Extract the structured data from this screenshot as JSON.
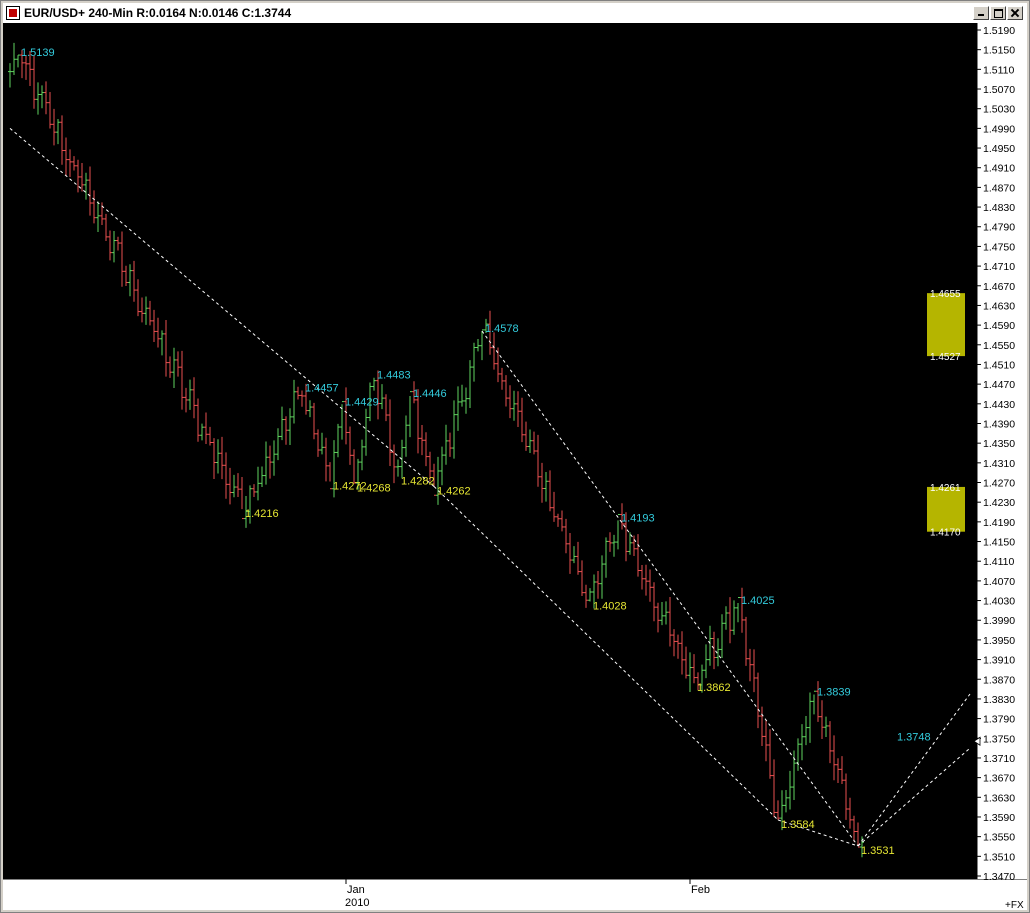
{
  "window": {
    "title": "EUR/USD+ 240-Min R:0.0164 N:0.0146 C:1.3744",
    "min_icon": "minimize-icon",
    "max_icon": "maximize-icon",
    "close_icon": "close-icon"
  },
  "colors": {
    "background": "#000000",
    "up_bar": "#5fd35f",
    "down_bar": "#e85050",
    "high_label": "#33ccdd",
    "low_label": "#e6e633",
    "trendline": "#ffffff",
    "zone_fill": "#b5b500",
    "price_scale_bg": "#ffffff"
  },
  "chart_data": {
    "type": "ohlc",
    "symbol": "EUR/USD+",
    "interval": "240-Min",
    "y_range": [
      1.347,
      1.521
    ],
    "y_ticks": [
      "1.5190",
      "1.5150",
      "1.5110",
      "1.5070",
      "1.5030",
      "1.4990",
      "1.4950",
      "1.4910",
      "1.4870",
      "1.4830",
      "1.4790",
      "1.4750",
      "1.4710",
      "1.4670",
      "1.4630",
      "1.4590",
      "1.4550",
      "1.4510",
      "1.4470",
      "1.4430",
      "1.4390",
      "1.4350",
      "1.4310",
      "1.4270",
      "1.4230",
      "1.4190",
      "1.4150",
      "1.4110",
      "1.4070",
      "1.4030",
      "1.3990",
      "1.3950",
      "1.3910",
      "1.3870",
      "1.3830",
      "1.3790",
      "1.3750",
      "1.3710",
      "1.3670",
      "1.3630",
      "1.3590",
      "1.3550",
      "1.3510",
      "1.3470"
    ],
    "bar_count": 214,
    "x_labels": [
      {
        "bar": 84,
        "month": "Jan",
        "year": "2010"
      },
      {
        "bar": 170,
        "month": "Feb",
        "year": ""
      }
    ],
    "last_price": 1.3744,
    "last_label_suffix": "+FX",
    "swing_points": [
      {
        "bar": 2,
        "price": 1.5139,
        "label": "1.5139",
        "kind": "high"
      },
      {
        "bar": 58,
        "price": 1.4216,
        "label": "1.4216",
        "kind": "low"
      },
      {
        "bar": 73,
        "price": 1.4457,
        "label": "1.4457",
        "kind": "high"
      },
      {
        "bar": 80,
        "price": 1.4272,
        "label": "1.4272",
        "kind": "low"
      },
      {
        "bar": 83,
        "price": 1.4429,
        "label": "1.4429",
        "kind": "high"
      },
      {
        "bar": 86,
        "price": 1.4268,
        "label": "1.4268",
        "kind": "low"
      },
      {
        "bar": 91,
        "price": 1.4483,
        "label": "1.4483",
        "kind": "high"
      },
      {
        "bar": 97,
        "price": 1.4282,
        "label": "1.4282",
        "kind": "low"
      },
      {
        "bar": 100,
        "price": 1.4446,
        "label": "1.4446",
        "kind": "high"
      },
      {
        "bar": 106,
        "price": 1.4262,
        "label": "1.4262",
        "kind": "low"
      },
      {
        "bar": 118,
        "price": 1.4578,
        "label": "1.4578",
        "kind": "high"
      },
      {
        "bar": 145,
        "price": 1.4028,
        "label": "1.4028",
        "kind": "low"
      },
      {
        "bar": 152,
        "price": 1.4193,
        "label": "1.4193",
        "kind": "high"
      },
      {
        "bar": 171,
        "price": 1.3862,
        "label": "1.3862",
        "kind": "low"
      },
      {
        "bar": 182,
        "price": 1.4025,
        "label": "1.4025",
        "kind": "high"
      },
      {
        "bar": 192,
        "price": 1.3584,
        "label": "1.3584",
        "kind": "low"
      },
      {
        "bar": 201,
        "price": 1.3839,
        "label": "1.3839",
        "kind": "high"
      },
      {
        "bar": 212,
        "price": 1.3531,
        "label": "1.3531",
        "kind": "low"
      },
      {
        "bar": 221,
        "price": 1.3748,
        "label": "1.3748",
        "kind": "high"
      }
    ],
    "trendlines": [
      {
        "from": {
          "bar": 0,
          "price": 1.499
        },
        "to": {
          "bar": 106,
          "price": 1.4262
        }
      },
      {
        "from": {
          "bar": 106,
          "price": 1.4262
        },
        "to": {
          "bar": 192,
          "price": 1.3584
        }
      },
      {
        "from": {
          "bar": 118,
          "price": 1.4578
        },
        "to": {
          "bar": 212,
          "price": 1.3531
        }
      },
      {
        "from": {
          "bar": 192,
          "price": 1.3584
        },
        "to": {
          "bar": 212,
          "price": 1.3531
        }
      },
      {
        "from": {
          "bar": 212,
          "price": 1.3531
        },
        "to": {
          "bar": 240,
          "price": 1.384
        }
      },
      {
        "from": {
          "bar": 212,
          "price": 1.3531
        },
        "to": {
          "bar": 240,
          "price": 1.373
        }
      }
    ],
    "zones": [
      {
        "top": 1.4655,
        "bottom": 1.4527,
        "top_label": "1.4655",
        "bottom_label": "1.4527"
      },
      {
        "top": 1.4261,
        "bottom": 1.417,
        "top_label": "1.4261",
        "bottom_label": "1.4170"
      }
    ]
  }
}
